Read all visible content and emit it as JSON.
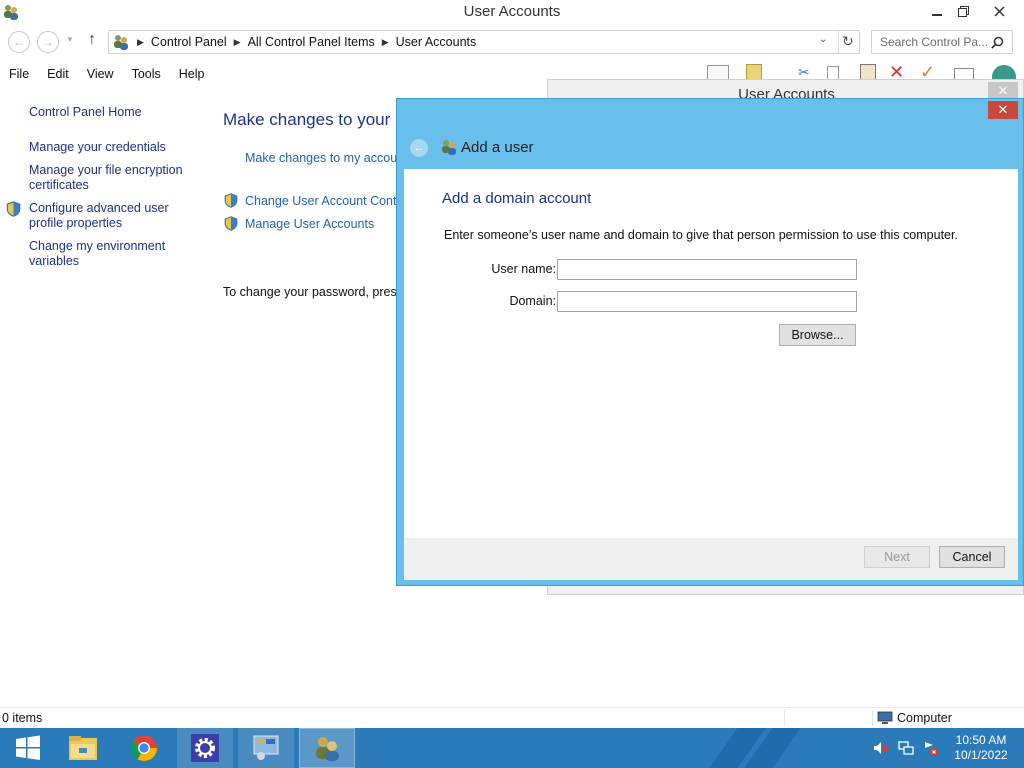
{
  "window": {
    "title": "User Accounts"
  },
  "address": {
    "crumbs": [
      "Control Panel",
      "All Control Panel Items",
      "User Accounts"
    ],
    "search_placeholder": "Search Control Pa..."
  },
  "menu": [
    "File",
    "Edit",
    "View",
    "Tools",
    "Help"
  ],
  "left_pane": {
    "home": "Control Panel Home",
    "links": [
      "Manage your credentials",
      "Manage your file encryption certificates",
      "Configure advanced user profile properties",
      "Change my environment variables"
    ]
  },
  "main": {
    "heading": "Make changes to your us",
    "link_changes": "Make changes to my accoun",
    "link_uac": "Change User Account Contro",
    "link_manage": "Manage User Accounts",
    "password_text": "To change your password, press"
  },
  "bg_dialog": {
    "title": "User Accounts"
  },
  "wizard": {
    "title": "Add a user",
    "heading": "Add a domain account",
    "description": "Enter someone’s user name and domain to give that person permission to use this computer.",
    "username_label": "User name:",
    "username_value": "",
    "domain_label": "Domain:",
    "domain_value": "",
    "browse_label": "Browse...",
    "next_label": "Next",
    "cancel_label": "Cancel"
  },
  "status": {
    "items": "0 items",
    "zone": "Computer"
  },
  "taskbar": {
    "time": "10:50 AM",
    "date": "10/1/2022"
  },
  "colors": {
    "wizard_frame": "#69bfeb",
    "link_blue": "#1e64b4",
    "heading_blue": "#1e3287",
    "taskbar": "#2b7ab9"
  }
}
